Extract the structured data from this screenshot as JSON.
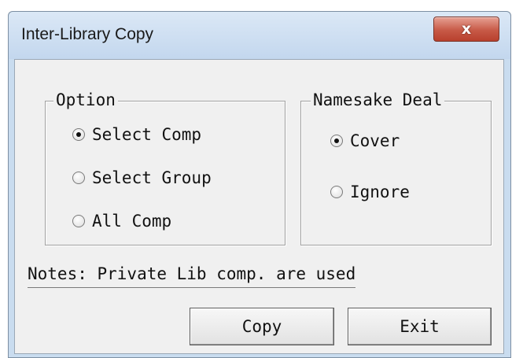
{
  "window": {
    "title": "Inter-Library Copy",
    "close_glyph": "x"
  },
  "option_group": {
    "label": "Option",
    "options": [
      {
        "label": "Select Comp",
        "checked": true
      },
      {
        "label": "Select Group",
        "checked": false
      },
      {
        "label": "All Comp",
        "checked": false
      }
    ]
  },
  "namesake_group": {
    "label": "Namesake Deal",
    "options": [
      {
        "label": "Cover",
        "checked": true
      },
      {
        "label": "Ignore",
        "checked": false
      }
    ]
  },
  "notes": "Notes: Private Lib comp. are used",
  "buttons": {
    "copy": "Copy",
    "exit": "Exit"
  },
  "colors": {
    "titlebar": "#c9dcef",
    "close_button": "#c75a47",
    "client_background": "#f0f0f0"
  },
  "icons": [
    "close-icon",
    "radio-checked-icon",
    "radio-unchecked-icon"
  ]
}
